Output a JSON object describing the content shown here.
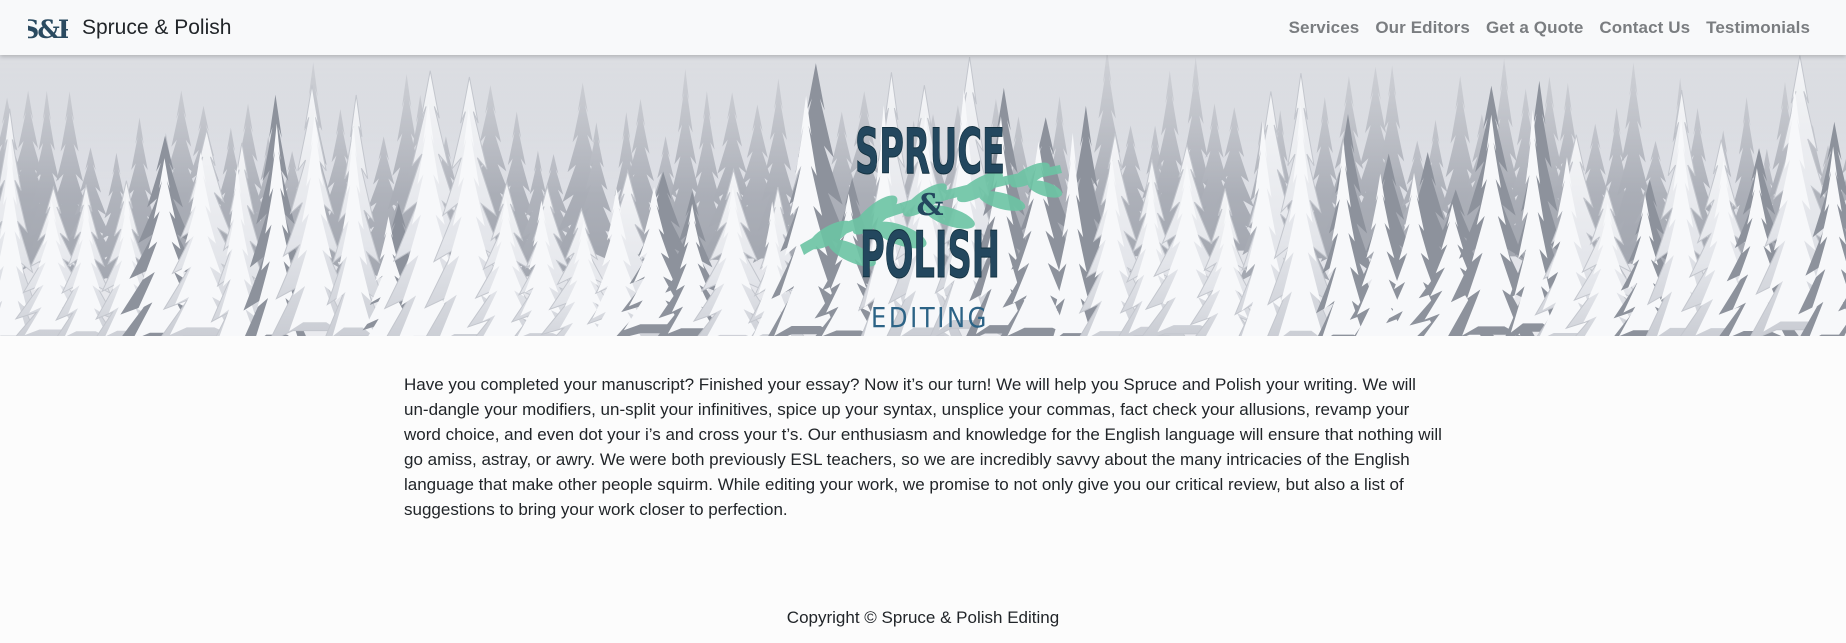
{
  "brand": {
    "logo_mark": "S&P",
    "name": "Spruce & Polish"
  },
  "nav": {
    "items": [
      {
        "label": "Services"
      },
      {
        "label": "Our Editors"
      },
      {
        "label": "Get a Quote"
      },
      {
        "label": "Contact Us"
      },
      {
        "label": "Testimonials"
      }
    ]
  },
  "hero": {
    "logo_line1": "SPRUCE",
    "logo_amp": "&",
    "logo_line2": "POLISH",
    "logo_line3": "EDITING",
    "colors": {
      "logo_ink": "#23475e",
      "leaf": "#6cc4a4"
    }
  },
  "main": {
    "intro": "Have you completed your manuscript? Finished your essay? Now it’s our turn! We will help you Spruce and Polish your writing. We will un-dangle your modifiers, un-split your infinitives, spice up your syntax, unsplice your commas, fact check your allusions, revamp your word choice, and even dot your i’s and cross your t’s. Our enthusiasm and knowledge for the English language will ensure that nothing will go amiss, astray, or awry. We were both previously ESL teachers, so we are incredibly savvy about the many intricacies of the English language that make other people squirm. While editing your work, we promise to not only give you our critical review, but also a list of suggestions to bring your work closer to perfection."
  },
  "footer": {
    "copyright": "Copyright © Spruce & Polish Editing"
  }
}
